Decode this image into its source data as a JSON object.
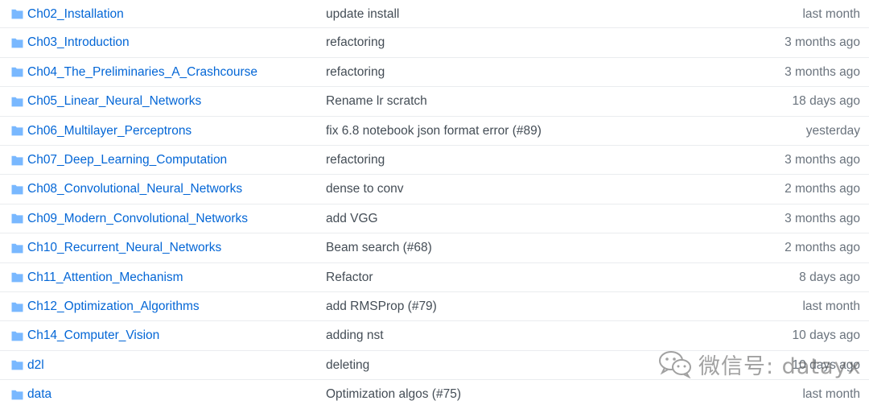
{
  "rows": [
    {
      "name": "Ch02_Installation",
      "message": "update install",
      "age": "last month"
    },
    {
      "name": "Ch03_Introduction",
      "message": "refactoring",
      "age": "3 months ago"
    },
    {
      "name": "Ch04_The_Preliminaries_A_Crashcourse",
      "message": "refactoring",
      "age": "3 months ago"
    },
    {
      "name": "Ch05_Linear_Neural_Networks",
      "message": "Rename lr scratch",
      "age": "18 days ago"
    },
    {
      "name": "Ch06_Multilayer_Perceptrons",
      "message": "fix 6.8 notebook json format error (#89)",
      "age": "yesterday"
    },
    {
      "name": "Ch07_Deep_Learning_Computation",
      "message": "refactoring",
      "age": "3 months ago"
    },
    {
      "name": "Ch08_Convolutional_Neural_Networks",
      "message": "dense to conv",
      "age": "2 months ago"
    },
    {
      "name": "Ch09_Modern_Convolutional_Networks",
      "message": "add VGG",
      "age": "3 months ago"
    },
    {
      "name": "Ch10_Recurrent_Neural_Networks",
      "message": "Beam search (#68)",
      "age": "2 months ago"
    },
    {
      "name": "Ch11_Attention_Mechanism",
      "message": "Refactor",
      "age": "8 days ago"
    },
    {
      "name": "Ch12_Optimization_Algorithms",
      "message": "add RMSProp (#79)",
      "age": "last month"
    },
    {
      "name": "Ch14_Computer_Vision",
      "message": "adding nst",
      "age": "10 days ago"
    },
    {
      "name": "d2l",
      "message": "deleting",
      "age": "10 days ago"
    },
    {
      "name": "data",
      "message": "Optimization algos (#75)",
      "age": "last month"
    }
  ],
  "icons": {
    "folder": "folder-icon",
    "watermark": "wechat-icon"
  },
  "watermark": {
    "text": "微信号: datayx"
  },
  "colors": {
    "link": "#0366d6",
    "message": "#444d56",
    "age": "#6a737d",
    "folder": "#79b8ff",
    "border": "#eaecef"
  }
}
